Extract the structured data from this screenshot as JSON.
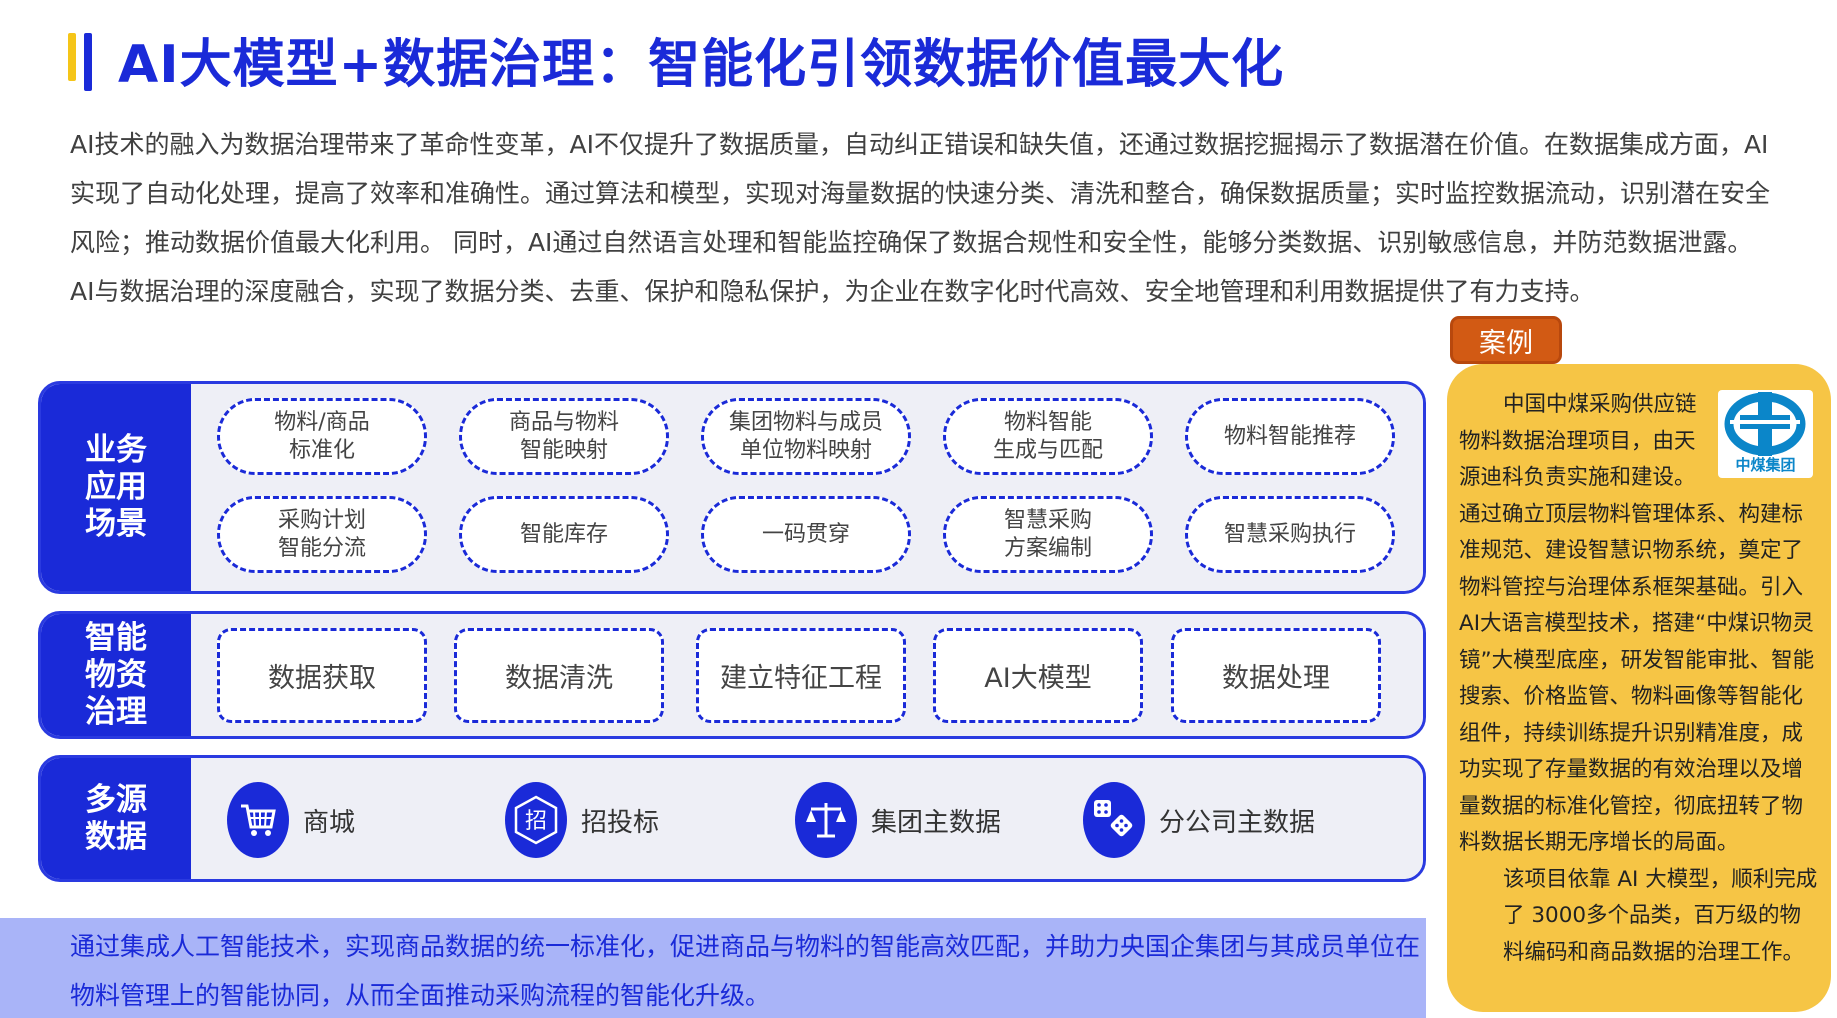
{
  "title": "AI大模型+数据治理：智能化引领数据价值最大化",
  "intro": "AI技术的融入为数据治理带来了革命性变革，AI不仅提升了数据质量，自动纠正错误和缺失值，还通过数据挖掘揭示了数据潜在价值。在数据集成方面，AI实现了自动化处理，提高了效率和准确性。通过算法和模型，实现对海量数据的快速分类、清洗和整合，确保数据质量；实时监控数据流动，识别潜在安全风险；推动数据价值最大化利用。 同时，AI通过自然语言处理和智能监控确保了数据合规性和安全性，能够分类数据、识别敏感信息，并防范数据泄露。AI与数据治理的深度融合，实现了数据分类、去重、保护和隐私保护，为企业在数字化时代高效、安全地管理和利用数据提供了有力支持。",
  "scenarios": {
    "header": "业务\n应用\n场景",
    "items": [
      "物料/商品\n标准化",
      "商品与物料\n智能映射",
      "集团物料与成员\n单位物料映射",
      "物料智能\n生成与匹配",
      "物料智能推荐",
      "采购计划\n智能分流",
      "智能库存",
      "一码贯穿",
      "智慧采购\n方案编制",
      "智慧采购执行"
    ]
  },
  "governance": {
    "header": "智能\n物资\n治理",
    "items": [
      "数据获取",
      "数据清洗",
      "建立特征工程",
      "AI大模型",
      "数据处理"
    ]
  },
  "sources": {
    "header": "多源\n数据",
    "items": [
      {
        "label": "商城",
        "icon": "shopping-cart-icon"
      },
      {
        "label": "招投标",
        "icon": "bidding-icon",
        "glyph": "招"
      },
      {
        "label": "集团主数据",
        "icon": "scale-icon"
      },
      {
        "label": "分公司主数据",
        "icon": "dice-icon"
      }
    ]
  },
  "summary": "通过集成人工智能技术，实现商品数据的统一标准化，促进商品与物料的智能高效匹配，并助力央国企集团与其成员单位在物料管理上的智能协同，从而全面推动采购流程的智能化升级。",
  "case": {
    "tag": "案例",
    "logo_text": "中煤集团",
    "para1_lines": [
      "中国中煤采购供应链",
      "物料数据治理项目，由天",
      "源迪科负责实施和建设。"
    ],
    "para2": "通过确立顶层物料管理体系、构建标准规范、建设智慧识物系统，奠定了物料管控与治理体系框架基础。引入AI大语言模型技术，搭建“中煤识物灵镜”大模型底座，研发智能审批、智能搜索、价格监管、物料画像等智能化组件，持续训练提升识别精准度，成功实现了存量数据的有效治理以及增量数据的标准化管控，彻底扭转了物料数据长期无序增长的局面。",
    "para3": "该项目依靠 AI 大模型，顺利完成了 3000多个品类，百万级的物料编码和商品数据的治理工作。"
  },
  "colors": {
    "primary": "#1a2ad8",
    "accent_yellow": "#f6c545",
    "tag_orange": "#d25a14",
    "band": "#a9b4f8"
  }
}
